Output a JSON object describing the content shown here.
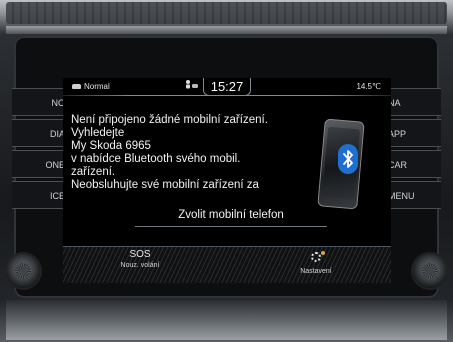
{
  "left_buttons": [
    "NO",
    "DIA",
    "ONE",
    "ICE"
  ],
  "right_buttons": [
    "NA",
    "APP",
    "CAR",
    "MENU"
  ],
  "status_bar": {
    "mode": "Normal",
    "time": "15:27",
    "temperature": "14.5℃"
  },
  "message_lines": [
    "Není připojeno žádné mobilní zařízení.",
    "Vyhledejte",
    "My Skoda 6965",
    "v nabídce Bluetooth svého mobil.",
    "zařízení.",
    "Neobsluhujte své mobilní zařízení za"
  ],
  "select_phone_label": "Zvolit mobilní telefon",
  "bottom_bar": {
    "sos_label": "SOS",
    "sos_sublabel": "Nouz. volání",
    "settings_label": "Nastavení"
  },
  "icons": {
    "bluetooth": "bluetooth-icon",
    "gear": "gear-icon",
    "car": "car-icon",
    "phone": "phone-icon"
  },
  "colors": {
    "bluetooth_blue": "#1f6fd1",
    "screen_bg": "#000000",
    "text": "#f2f2f2"
  }
}
